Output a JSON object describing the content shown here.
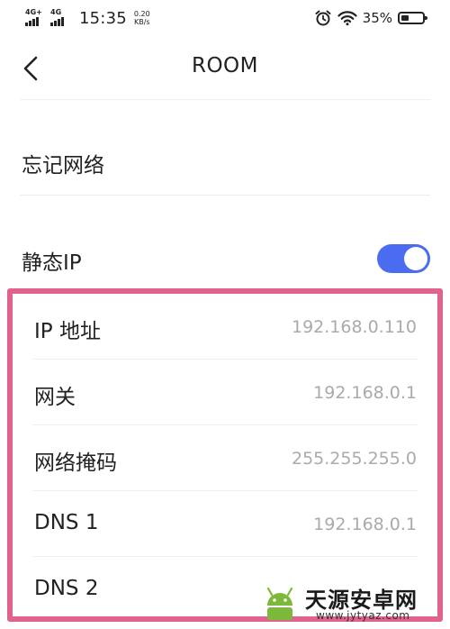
{
  "status_bar": {
    "network1_label": "4G+",
    "network2_label": "4G",
    "time": "15:35",
    "speed_value": "0.20",
    "speed_unit": "KB/s",
    "battery_percent": "35%",
    "battery_level": 0.35,
    "icons": [
      "alarm-icon",
      "wifi-icon",
      "battery-icon"
    ]
  },
  "header": {
    "title": "ROOM",
    "back_icon": "chevron-left-icon"
  },
  "actions": {
    "forget_network": "忘记网络"
  },
  "static_ip": {
    "label": "静态IP",
    "toggle_on": true,
    "toggle_color": "#4a6cf0"
  },
  "fields": [
    {
      "label": "IP 地址",
      "value": "192.168.0.110"
    },
    {
      "label": "网关",
      "value": "192.168.0.1"
    },
    {
      "label": "网络掩码",
      "value": "255.255.255.0"
    },
    {
      "label": "DNS 1",
      "value": "192.168.0.1"
    },
    {
      "label": "DNS 2",
      "value": ""
    }
  ],
  "highlight_color": "#e0628f",
  "watermark": {
    "title": "天源安卓网",
    "url": "www.jytyaz.com"
  }
}
